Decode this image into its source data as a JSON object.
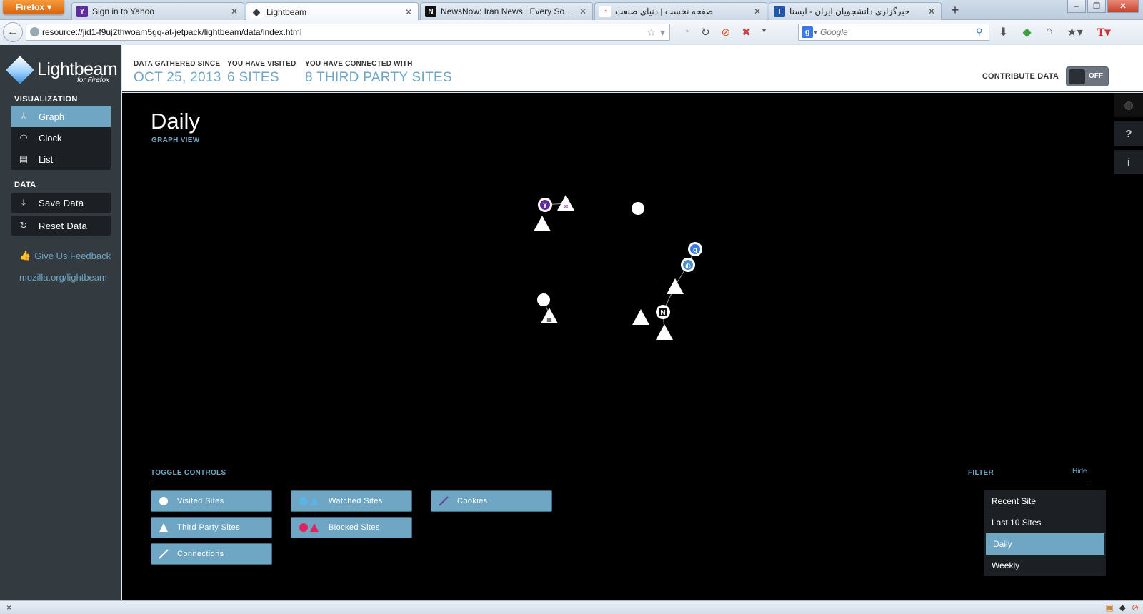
{
  "browser": {
    "menu_button": "Firefox",
    "tabs": [
      {
        "label": "Sign in to Yahoo",
        "favicon": "Y",
        "favicon_color": "#5f2d9b"
      },
      {
        "label": "Lightbeam",
        "favicon": "◆",
        "favicon_color": "#333b41"
      },
      {
        "label": "NewsNow: Iran News | Every Source, ...",
        "favicon": "N",
        "favicon_color": "#111111"
      },
      {
        "label": "صفحه نخست | دنیای صنعت",
        "favicon": "◔",
        "favicon_color": "#d9534f"
      },
      {
        "label": "خبرگزاری دانشجویان ایران - ایسنا",
        "favicon": "I",
        "favicon_color": "#2356a8"
      }
    ],
    "url": "resource://jid1-f9uj2thwoam5gq-at-jetpack/lightbeam/data/index.html",
    "search_placeholder": "Google",
    "status_close": "×"
  },
  "sidebar": {
    "logo_title": "Lightbeam",
    "logo_subtitle": "for Firefox",
    "visualization_heading": "VISUALIZATION",
    "visualization_items": [
      {
        "label": "Graph",
        "icon": "graph-icon",
        "glyph": "⅄",
        "active": true
      },
      {
        "label": "Clock",
        "icon": "clock-icon",
        "glyph": "◠",
        "active": false
      },
      {
        "label": "List",
        "icon": "list-icon",
        "glyph": "▤",
        "active": false
      }
    ],
    "data_heading": "DATA",
    "save_label": "Save Data",
    "reset_label": "Reset Data",
    "feedback_label": "Give Us Feedback",
    "site_link": "mozilla.org/lightbeam"
  },
  "stats": {
    "since_label": "DATA GATHERED SINCE",
    "since_value": "OCT 25, 2013",
    "visited_label": "YOU HAVE VISITED",
    "visited_value": "6 SITES",
    "connected_label": "YOU HAVE CONNECTED WITH",
    "connected_value": "8 THIRD PARTY SITES",
    "contribute_label": "CONTRIBUTE DATA",
    "contribute_state": "OFF"
  },
  "view": {
    "title": "Daily",
    "subtitle": "GRAPH VIEW"
  },
  "colors": {
    "accent": "#6fa6c4",
    "watched": "#5ab4e5",
    "blocked": "#e0245e",
    "sidebar_bg": "#333b41"
  },
  "graph": {
    "nodes": [
      {
        "id": "yahoo",
        "kind": "visited",
        "label": "Y"
      },
      {
        "id": "yahoo-tp-1",
        "kind": "third-party",
        "label": "✉"
      },
      {
        "id": "yahoo-tp-2",
        "kind": "third-party",
        "label": ""
      },
      {
        "id": "site-a",
        "kind": "visited",
        "label": ""
      },
      {
        "id": "site-b",
        "kind": "visited",
        "label": ""
      },
      {
        "id": "site-b-tp",
        "kind": "third-party",
        "label": "▦"
      },
      {
        "id": "google",
        "kind": "visited",
        "label": "g"
      },
      {
        "id": "google-2",
        "kind": "visited",
        "label": "◐"
      },
      {
        "id": "newsnow",
        "kind": "visited",
        "label": "N"
      },
      {
        "id": "news-tp-1",
        "kind": "third-party",
        "label": ""
      },
      {
        "id": "news-tp-2",
        "kind": "third-party",
        "label": ""
      },
      {
        "id": "news-tp-3",
        "kind": "third-party",
        "label": ""
      }
    ],
    "links": [
      [
        "yahoo",
        "yahoo-tp-1"
      ],
      [
        "site-b",
        "site-b-tp"
      ],
      [
        "google",
        "google-2"
      ],
      [
        "google-2",
        "news-tp-1"
      ],
      [
        "news-tp-1",
        "newsnow"
      ],
      [
        "newsnow",
        "news-tp-3"
      ]
    ]
  },
  "side_tools": [
    {
      "name": "globe-icon",
      "glyph": "◍"
    },
    {
      "name": "help-icon",
      "glyph": "?"
    },
    {
      "name": "info-icon",
      "glyph": "i"
    }
  ],
  "controls": {
    "toggle_heading": "TOGGLE CONTROLS",
    "filter_heading": "FILTER",
    "hide_label": "Hide",
    "toggles": [
      {
        "label": "Visited Sites",
        "icon": "visited-circle-icon"
      },
      {
        "label": "Third Party Sites",
        "icon": "third-party-triangle-icon"
      },
      {
        "label": "Connections",
        "icon": "connection-line-icon"
      },
      {
        "label": "Watched Sites",
        "icon": "watched-icon"
      },
      {
        "label": "Blocked Sites",
        "icon": "blocked-icon"
      },
      {
        "label": "Cookies",
        "icon": "cookie-line-icon"
      }
    ],
    "filters": [
      {
        "label": "Recent Site",
        "active": false
      },
      {
        "label": "Last 10 Sites",
        "active": false
      },
      {
        "label": "Daily",
        "active": true
      },
      {
        "label": "Weekly",
        "active": false
      }
    ]
  }
}
